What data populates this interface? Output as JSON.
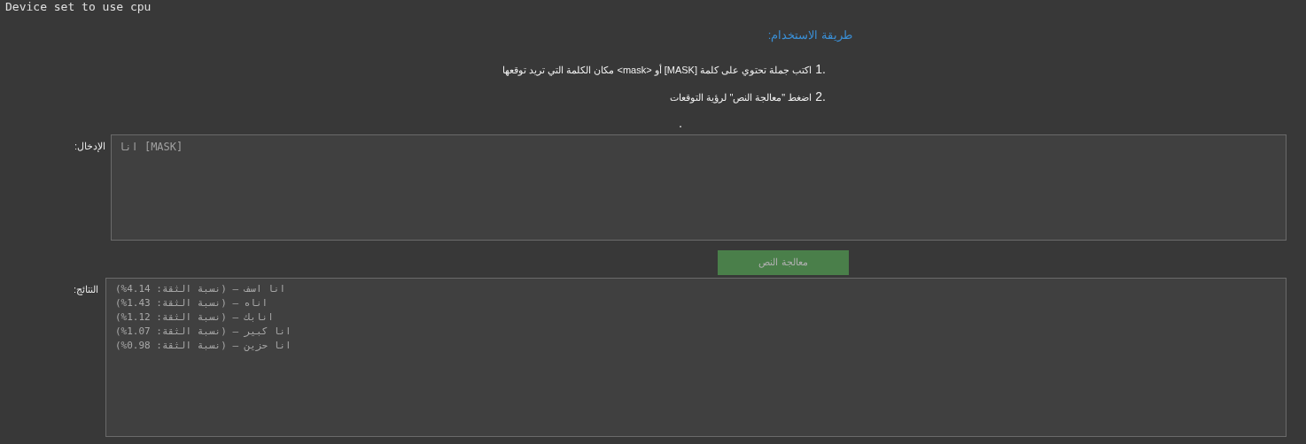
{
  "log_line": "Device set to use cpu",
  "usage": {
    "title": "طريقة الاستخدام:",
    "step_numbers": [
      "1.",
      "2."
    ],
    "steps": [
      "اكتب جملة تحتوي على كلمة [MASK] أو <mask> مكان الكلمة التي تريد توقعها",
      "اضغط \"معالجة النص\" لرؤية التوقعات"
    ],
    "note": "."
  },
  "input": {
    "label": "الإدخال:",
    "value": "انا [MASK]"
  },
  "process_button": "معالجة النص",
  "results": {
    "label": "النتائج:",
    "lines": [
      "انا اسف — (نسبة الثقة: 4.14%)",
      "اناه — (نسبة الثقة: 1.43%)",
      "انابك — (نسبة الثقة: 1.12%)",
      "انا كبير — (نسبة الثقة: 1.07%)",
      "انا حزين — (نسبة الثقة: 0.98%)"
    ]
  }
}
